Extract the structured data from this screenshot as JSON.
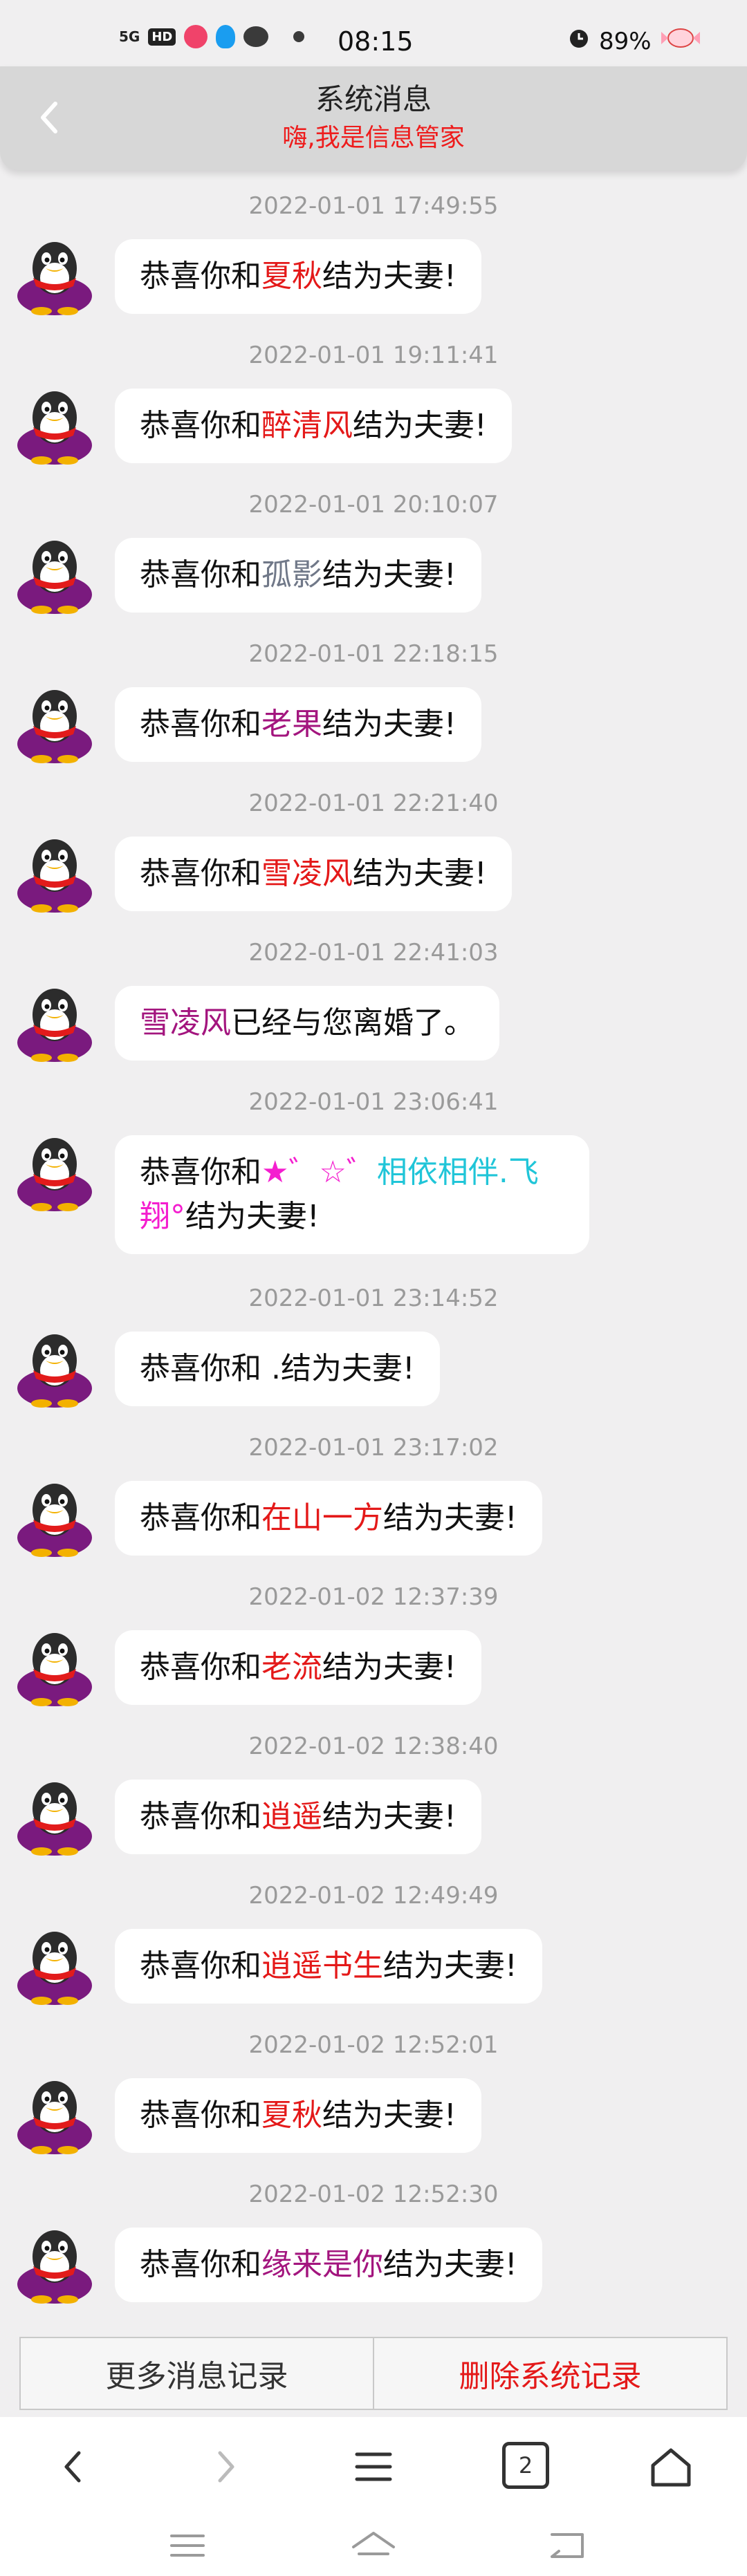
{
  "status_bar": {
    "network": "5G",
    "hd": "HD",
    "time": "08:15",
    "battery": "89%",
    "icons": [
      "signal-icon",
      "hd-icon",
      "app-red-icon",
      "qq-icon",
      "wechat-icon",
      "dot-icon",
      "alarm-icon",
      "battery-candy-icon"
    ]
  },
  "header": {
    "title": "系统消息",
    "subtitle": "嗨,我是信息管家"
  },
  "messages": [
    {
      "time": "2022-01-01 17:49:55",
      "pre": "恭喜你和",
      "name": "夏秋",
      "post": "结为夫妻!",
      "color": "red"
    },
    {
      "time": "2022-01-01 19:11:41",
      "pre": "恭喜你和",
      "name": "醉清风",
      "post": "结为夫妻!",
      "color": "red"
    },
    {
      "time": "2022-01-01 20:10:07",
      "pre": "恭喜你和",
      "name": "孤影",
      "post": "结为夫妻!",
      "color": "gray"
    },
    {
      "time": "2022-01-01 22:18:15",
      "pre": "恭喜你和",
      "name": "老果",
      "post": "结为夫妻!",
      "color": "purple"
    },
    {
      "time": "2022-01-01 22:21:40",
      "pre": "恭喜你和",
      "name": "雪凌风",
      "post": "结为夫妻!",
      "color": "red"
    },
    {
      "time": "2022-01-01 22:41:03",
      "pre": "",
      "name": "雪凌风",
      "post": "已经与您离婚了。",
      "color": "purple"
    },
    {
      "time": "2022-01-01 23:06:41",
      "pre": "恭喜你和",
      "name_a": "★゛☆゛",
      "name_b": "相依相伴.飞",
      "name_c": "翔°",
      "post": "结为夫妻!",
      "color": "multi"
    },
    {
      "time": "2022-01-01 23:14:52",
      "pre": "恭喜你和",
      "name": " .",
      "post": "结为夫妻!",
      "color": "none"
    },
    {
      "time": "2022-01-01 23:17:02",
      "pre": "恭喜你和",
      "name": "在山一方",
      "post": "结为夫妻!",
      "color": "red"
    },
    {
      "time": "2022-01-02 12:37:39",
      "pre": "恭喜你和",
      "name": "老流",
      "post": "结为夫妻!",
      "color": "red"
    },
    {
      "time": "2022-01-02 12:38:40",
      "pre": "恭喜你和",
      "name": "逍遥",
      "post": "结为夫妻!",
      "color": "red"
    },
    {
      "time": "2022-01-02 12:49:49",
      "pre": "恭喜你和",
      "name": "逍遥书生",
      "post": "结为夫妻!",
      "color": "red"
    },
    {
      "time": "2022-01-02 12:52:01",
      "pre": "恭喜你和",
      "name": "夏秋",
      "post": "结为夫妻!",
      "color": "red"
    },
    {
      "time": "2022-01-02 12:52:30",
      "pre": "恭喜你和",
      "name": "缘来是你",
      "post": "结为夫妻!",
      "color": "purple"
    }
  ],
  "footer": {
    "more_label": "更多消息记录",
    "delete_label": "删除系统记录"
  },
  "browser_bar": {
    "tab_count": "2",
    "icons": [
      "back-icon",
      "forward-icon",
      "menu-icon",
      "tabs-icon",
      "home-icon"
    ]
  },
  "system_nav": {
    "icons": [
      "recents-icon",
      "home-icon",
      "back-icon"
    ]
  },
  "colors": {
    "accent_red": "#e41919",
    "purple": "#a3157e",
    "gray_name": "#707888",
    "magenta": "#f41ecf",
    "cyan": "#20c5d8",
    "header_bg": "#d7d7d7",
    "page_bg": "#f0eff0"
  }
}
